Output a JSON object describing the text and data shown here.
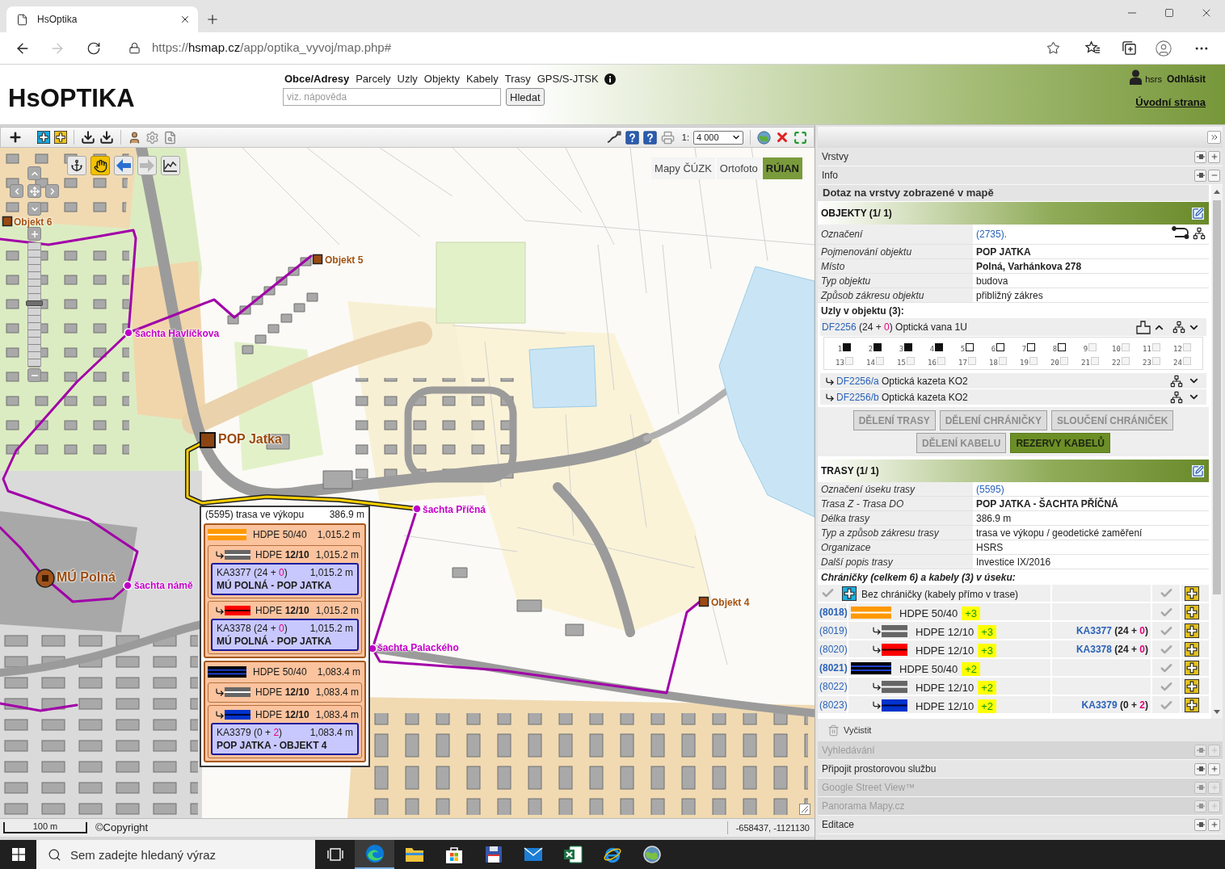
{
  "browser": {
    "tab_title": "HsOptika",
    "back_disabled": false,
    "forward_disabled": true,
    "url": {
      "scheme": "https://",
      "host": "hsmap.cz",
      "path": "/app/optika_vyvoj/map.php#"
    }
  },
  "header": {
    "logo": "HsOPTIKA",
    "nav": [
      {
        "label": "Obce/Adresy",
        "selected": true
      },
      {
        "label": "Parcely",
        "selected": false
      },
      {
        "label": "Uzly",
        "selected": false
      },
      {
        "label": "Objekty",
        "selected": false
      },
      {
        "label": "Kabely",
        "selected": false
      },
      {
        "label": "Trasy",
        "selected": false
      },
      {
        "label": "GPS/S-JTSK",
        "selected": false
      }
    ],
    "search": {
      "placeholder": "viz. nápověda",
      "button": "Hledat"
    },
    "user": "hsrs",
    "logout": "Odhlásit",
    "home": "Úvodní strana"
  },
  "map": {
    "toolbar": {
      "scale_prefix": "1:",
      "scale": "4 000"
    },
    "tools": [
      {
        "kind": "anchor",
        "selected": false,
        "disabled": false
      },
      {
        "kind": "pan",
        "selected": true,
        "disabled": false
      },
      {
        "kind": "back",
        "selected": false,
        "disabled": false
      },
      {
        "kind": "forward",
        "selected": false,
        "disabled": true
      },
      {
        "kind": "profile",
        "selected": false,
        "disabled": false
      }
    ],
    "zoom": {
      "level": 0.52
    },
    "layers": [
      {
        "label": "Mapy ČÚZK",
        "selected": false
      },
      {
        "label": "Ortofoto",
        "selected": false
      },
      {
        "label": "RÚIAN",
        "selected": true
      }
    ],
    "features": [
      {
        "kind": "object",
        "label": "Objekt 6"
      },
      {
        "kind": "object",
        "label": "Objekt 5"
      },
      {
        "kind": "shaft",
        "label": "šachta Havlíčkova"
      },
      {
        "kind": "pop",
        "label": "POP Jatka"
      },
      {
        "kind": "shaft",
        "label": "šachta Příčná"
      },
      {
        "kind": "office",
        "label": "MÚ Polná"
      },
      {
        "kind": "shaft",
        "label": "šachta námě"
      },
      {
        "kind": "shaft",
        "label": "šachta Palackého"
      },
      {
        "kind": "object",
        "label": "Objekt 4"
      }
    ],
    "popup": {
      "title": "(5595) trasa ve výkopu",
      "length": "386.9 m",
      "ducts": [
        {
          "name": "HDPE 50/40",
          "length": "1,015.2 m",
          "color": "#ff9900",
          "stripes": [
            {
              "color": "#ffffff"
            }
          ],
          "children": [
            {
              "name": "HDPE **12/10**",
              "length": "1,015.2 m",
              "color": "#666666",
              "stripes": [
                {
                  "color": "#ffffff"
                }
              ],
              "cable": {
                "title": [
                  {
                    "kind": "plain",
                    "text": "KA3377 (24 + "
                  },
                  {
                    "kind": "accent",
                    "text": "0"
                  },
                  {
                    "kind": "plain",
                    "text": ")"
                  }
                ],
                "length": "1,015.2 m",
                "route": "MÚ POLNÁ - POP JATKA"
              }
            },
            {
              "name": "HDPE **12/10**",
              "length": "1,015.2 m",
              "color": "#ff0000",
              "stripes": [
                {
                  "color": "#330000"
                }
              ],
              "cable": {
                "title": [
                  {
                    "kind": "plain",
                    "text": "KA3378 (24 + "
                  },
                  {
                    "kind": "accent",
                    "text": "0"
                  },
                  {
                    "kind": "plain",
                    "text": ")"
                  }
                ],
                "length": "1,015.2 m",
                "route": "MÚ POLNÁ - POP JATKA"
              }
            }
          ]
        },
        {
          "name": "HDPE 50/40",
          "length": "1,083.4 m",
          "color": "#000000",
          "stripes": [
            {
              "color": "#2040d0"
            },
            {
              "color": "#2040d0"
            }
          ],
          "children": [
            {
              "name": "HDPE **12/10**",
              "length": "1,083.4 m",
              "color": "#666666",
              "stripes": [
                {
                  "color": "#ffffff"
                }
              ]
            },
            {
              "name": "HDPE **12/10**",
              "length": "1,083.4 m",
              "color": "#0033cc",
              "stripes": [
                {
                  "color": "#000033"
                }
              ],
              "cable": {
                "title": [
                  {
                    "kind": "plain",
                    "text": "KA3379 (0 + "
                  },
                  {
                    "kind": "accent",
                    "text": "2"
                  },
                  {
                    "kind": "plain",
                    "text": ")"
                  }
                ],
                "length": "1,083.4 m",
                "route": "POP JATKA - OBJEKT 4"
              }
            }
          ]
        }
      ]
    },
    "scale_bar": "100 m",
    "copyright": "©Copyright",
    "coordinates": "-658437, -1121130"
  },
  "panel": {
    "headers_top": [
      {
        "label": "Vrstvy",
        "expanded": false,
        "disabled": false
      },
      {
        "label": "Info",
        "expanded": true,
        "disabled": false
      }
    ],
    "query_title": "Dotaz na vrstvy zobrazené v mapě",
    "objects": {
      "title": "OBJEKTY (1/ 1)",
      "rows": [
        {
          "label": "Označení",
          "value": "(2735).",
          "kind": "link"
        },
        {
          "label": "Pojmenování objektu",
          "value": "POP JATKA",
          "kind": "bold"
        },
        {
          "label": "Místo",
          "value": "Polná, Varhánkova 278",
          "kind": "bold"
        },
        {
          "label": "Typ objektu",
          "value": "budova",
          "kind": "plain"
        },
        {
          "label": "Způsob zákresu objektu",
          "value": "přibližný zákres",
          "kind": "plain"
        }
      ],
      "nodes_title": "Uzly v objektu (3):",
      "nodes": [
        {
          "title": [
            {
              "kind": "link",
              "text": "DF2256"
            },
            {
              "kind": "plain",
              "text": " (24 + "
            },
            {
              "kind": "accent",
              "text": "0"
            },
            {
              "kind": "plain",
              "text": ") Optická vana 1U"
            }
          ],
          "ports": [
            {
              "number": "1",
              "used": true,
              "disabled": false
            },
            {
              "number": "2",
              "used": true,
              "disabled": false
            },
            {
              "number": "3",
              "used": true,
              "disabled": false
            },
            {
              "number": "4",
              "used": true,
              "disabled": false
            },
            {
              "number": "5",
              "used": false,
              "disabled": false
            },
            {
              "number": "6",
              "used": false,
              "disabled": false
            },
            {
              "number": "7",
              "used": false,
              "disabled": false
            },
            {
              "number": "8",
              "used": false,
              "disabled": false
            },
            {
              "number": "9",
              "used": false,
              "disabled": true
            },
            {
              "number": "10",
              "used": false,
              "disabled": true
            },
            {
              "number": "11",
              "used": false,
              "disabled": true
            },
            {
              "number": "12",
              "used": false,
              "disabled": true
            },
            {
              "number": "13",
              "used": false,
              "disabled": true
            },
            {
              "number": "14",
              "used": false,
              "disabled": true
            },
            {
              "number": "15",
              "used": false,
              "disabled": true
            },
            {
              "number": "16",
              "used": false,
              "disabled": true
            },
            {
              "number": "17",
              "used": false,
              "disabled": true
            },
            {
              "number": "18",
              "used": false,
              "disabled": true
            },
            {
              "number": "19",
              "used": false,
              "disabled": true
            },
            {
              "number": "20",
              "used": false,
              "disabled": true
            },
            {
              "number": "21",
              "used": false,
              "disabled": true
            },
            {
              "number": "22",
              "used": false,
              "disabled": true
            },
            {
              "number": "23",
              "used": false,
              "disabled": true
            },
            {
              "number": "24",
              "used": false,
              "disabled": true
            }
          ],
          "children": [
            {
              "title": [
                {
                  "kind": "link",
                  "text": "DF2256/a"
                },
                {
                  "kind": "plain",
                  "text": " Optická kazeta KO2"
                }
              ]
            },
            {
              "title": [
                {
                  "kind": "link",
                  "text": "DF2256/b"
                },
                {
                  "kind": "plain",
                  "text": " Optická kazeta KO2"
                }
              ]
            }
          ]
        }
      ]
    },
    "actions": [
      {
        "label": "DĚLENÍ TRASY",
        "disabled": true
      },
      {
        "label": "DĚLENÍ CHRÁNIČKY",
        "disabled": true
      },
      {
        "label": "SLOUČENÍ CHRÁNIČEK",
        "disabled": true
      },
      {
        "label": "DĚLENÍ KABELU",
        "disabled": true
      },
      {
        "label": "REZERVY KABELŮ",
        "disabled": false
      }
    ],
    "routes": {
      "title": "TRASY (1/ 1)",
      "rows": [
        {
          "label": "Označení úseku trasy",
          "value": "(5595)",
          "kind": "link"
        },
        {
          "label": "Trasa Z - Trasa DO",
          "value": "POP JATKA - ŠACHTA PŘÍČNÁ",
          "kind": "bold"
        },
        {
          "label": "Délka trasy",
          "value": "386.9 m",
          "kind": "plain"
        },
        {
          "label": "Typ a způsob zákresu trasy",
          "value": "trasa ve výkopu / geodetické zaměření",
          "kind": "plain"
        },
        {
          "label": "Organizace",
          "value": "HSRS",
          "kind": "plain"
        },
        {
          "label": "Další popis trasy",
          "value": "Investice IX/2016",
          "kind": "plain"
        }
      ],
      "ducts_title": "Chráničky (celkem 6) a kabely (3) v úseku:",
      "no_duct": "Bez chráničky (kabely přímo v trase)",
      "ducts": [
        {
          "id": "(8018)",
          "name": "HDPE 50/40",
          "badge": "+3",
          "color": "#ff9900",
          "stripes": [
            {
              "color": "#ffffff"
            }
          ],
          "children": [
            {
              "id": "(8019)",
              "name": "HDPE 12/10",
              "badge": "+3",
              "color": "#666666",
              "stripes": [
                {
                  "color": "#ffffff"
                }
              ],
              "cable": [
                {
                  "kind": "link",
                  "text": "KA3377"
                },
                {
                  "kind": "plain",
                  "text": " (24 + "
                },
                {
                  "kind": "accent",
                  "text": "0"
                },
                {
                  "kind": "plain",
                  "text": ")"
                }
              ]
            },
            {
              "id": "(8020)",
              "name": "HDPE 12/10",
              "badge": "+3",
              "color": "#ff0000",
              "stripes": [
                {
                  "color": "#330000"
                }
              ],
              "cable": [
                {
                  "kind": "link",
                  "text": "KA3378"
                },
                {
                  "kind": "plain",
                  "text": " (24 + "
                },
                {
                  "kind": "accent",
                  "text": "0"
                },
                {
                  "kind": "plain",
                  "text": ")"
                }
              ]
            }
          ]
        },
        {
          "id": "(8021)",
          "name": "HDPE 50/40",
          "badge": "+2",
          "color": "#000000",
          "stripes": [
            {
              "color": "#2040d0"
            },
            {
              "color": "#2040d0"
            }
          ],
          "children": [
            {
              "id": "(8022)",
              "name": "HDPE 12/10",
              "badge": "+2",
              "color": "#666666",
              "stripes": [
                {
                  "color": "#ffffff"
                }
              ]
            },
            {
              "id": "(8023)",
              "name": "HDPE 12/10",
              "badge": "+2",
              "color": "#0033cc",
              "stripes": [
                {
                  "color": "#000033"
                }
              ],
              "cable": [
                {
                  "kind": "link",
                  "text": "KA3379"
                },
                {
                  "kind": "plain",
                  "text": " (0 + "
                },
                {
                  "kind": "accent",
                  "text": "2"
                },
                {
                  "kind": "plain",
                  "text": ")"
                }
              ]
            }
          ]
        }
      ]
    },
    "clear": "Vyčistit",
    "headers_bottom": [
      {
        "label": "Vyhledávání",
        "expanded": false,
        "disabled": true
      },
      {
        "label": "Připojit prostorovou službu",
        "expanded": false,
        "disabled": false
      },
      {
        "label": "Google Street View™",
        "expanded": false,
        "disabled": true
      },
      {
        "label": "Panorama Mapy.cz",
        "expanded": false,
        "disabled": true
      },
      {
        "label": "Editace",
        "expanded": false,
        "disabled": false
      }
    ]
  },
  "taskbar": {
    "search_placeholder": "Sem zadejte hledaný výraz",
    "apps": [
      {
        "kind": "task_view",
        "active": false
      },
      {
        "kind": "edge",
        "active": true
      },
      {
        "kind": "explorer",
        "active": false
      },
      {
        "kind": "store",
        "active": false
      },
      {
        "kind": "save_app",
        "active": false
      },
      {
        "kind": "mail",
        "active": false
      },
      {
        "kind": "excel",
        "active": false
      },
      {
        "kind": "ie",
        "active": false
      },
      {
        "kind": "globe",
        "active": false
      }
    ]
  }
}
